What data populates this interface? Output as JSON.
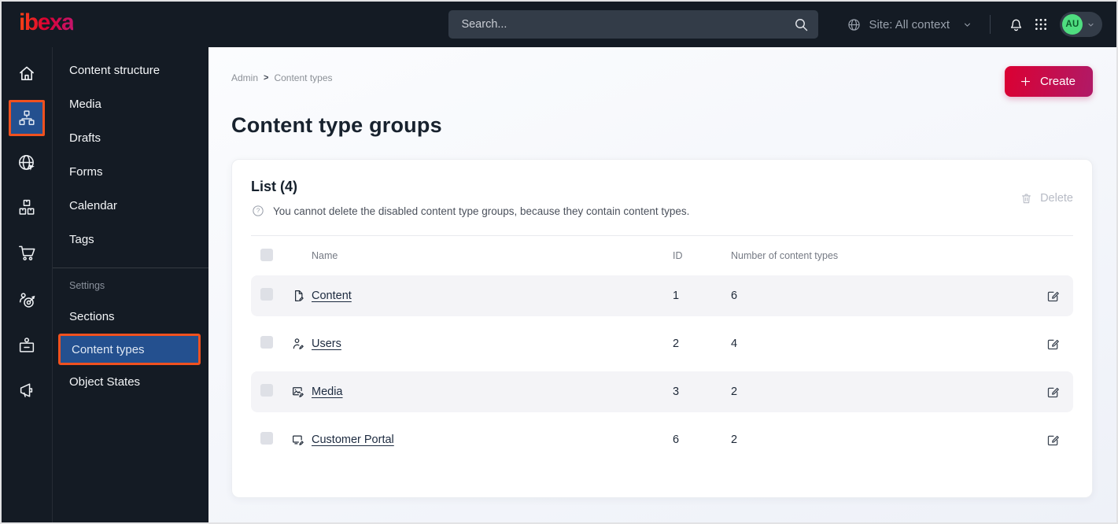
{
  "brand": {
    "logo_text": "ibexa"
  },
  "topbar": {
    "search_placeholder": "Search...",
    "site_context_label": "Site: All context",
    "avatar_initials": "AU"
  },
  "icon_rail": {
    "icons": [
      "home-icon",
      "content-tree-icon",
      "site-globe-cursor-icon",
      "product-boxes-icon",
      "shopping-cart-icon",
      "customer-segments-target-icon",
      "corporate-badge-icon",
      "marketing-megaphone-icon"
    ],
    "active_index": 1
  },
  "side_menu": {
    "items": [
      {
        "label": "Content structure"
      },
      {
        "label": "Media"
      },
      {
        "label": "Drafts"
      },
      {
        "label": "Forms"
      },
      {
        "label": "Calendar"
      },
      {
        "label": "Tags"
      }
    ],
    "settings": {
      "label": "Settings",
      "items": [
        {
          "label": "Sections",
          "active": false
        },
        {
          "label": "Content types",
          "active": true
        },
        {
          "label": "Object States",
          "active": false
        }
      ]
    }
  },
  "main": {
    "breadcrumb": {
      "items": [
        "Admin",
        "Content types"
      ],
      "separator": ">"
    },
    "create_button_label": "Create",
    "page_title": "Content type groups",
    "list_card": {
      "title": "List (4)",
      "info_text": "You cannot delete the disabled content type groups, because they contain content types.",
      "delete_button_label": "Delete",
      "table": {
        "headers": {
          "name": "Name",
          "id": "ID",
          "count": "Number of content types"
        },
        "rows": [
          {
            "icon": "content-file-icon",
            "name": "Content",
            "id": "1",
            "count": "6"
          },
          {
            "icon": "users-person-icon",
            "name": "Users",
            "id": "2",
            "count": "4"
          },
          {
            "icon": "media-image-icon",
            "name": "Media",
            "id": "3",
            "count": "2"
          },
          {
            "icon": "customer-portal-monitor-icon",
            "name": "Customer Portal",
            "id": "6",
            "count": "2"
          }
        ]
      }
    }
  },
  "colors": {
    "topbar_bg": "#141b24",
    "active_highlight_blue": "#24508f",
    "annotation_orange": "#f0511f",
    "brand_red": "#db0032",
    "brand_magenta": "#b01a67",
    "avatar_green": "#4fdd80",
    "row_alt_bg": "#f4f4f7"
  }
}
